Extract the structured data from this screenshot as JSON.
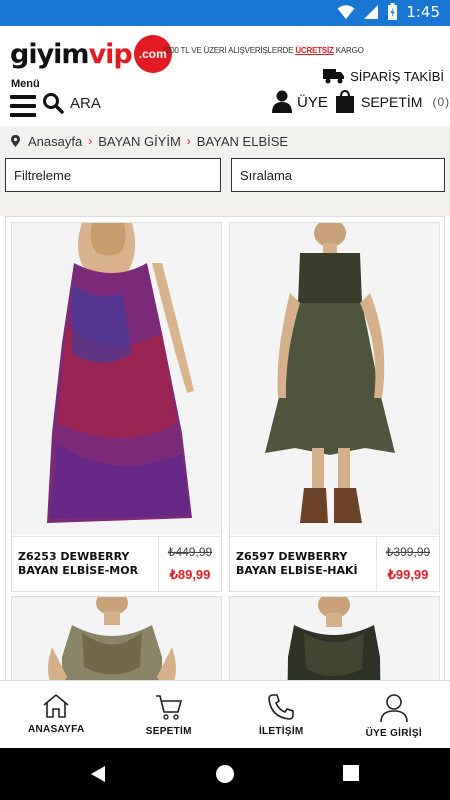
{
  "status_bar": {
    "time": "1:45"
  },
  "header": {
    "logo_text_main": "giyim",
    "logo_text_accent": "vip",
    "logo_badge": ".com",
    "promo_prefix": "*200 TL VE ÜZERİ ALIŞVERİŞLERDE",
    "promo_highlight": "ÜCRETSİZ",
    "promo_suffix": "KARGO",
    "order_tracking_label": "SİPARİŞ TAKİBİ",
    "menu_label": "Menü",
    "search_label": "ARA",
    "account_label": "ÜYE",
    "cart_label": "SEPETİM",
    "cart_count": "(0)"
  },
  "breadcrumb": {
    "items": [
      "Anasayfa",
      "BAYAN GİYİM",
      "BAYAN ELBİSE"
    ]
  },
  "filters": {
    "filter_label": "Filtreleme",
    "sort_label": "Sıralama"
  },
  "products": [
    {
      "name": "Z6253 DEWBERRY BAYAN ELBİSE-MOR",
      "old_price": "₺449,99",
      "new_price": "₺89,99",
      "color": "#7b2a7a"
    },
    {
      "name": "Z6597 DEWBERRY BAYAN ELBİSE-HAKİ",
      "old_price": "₺399,99",
      "new_price": "₺99,99",
      "color": "#4f553c"
    },
    {
      "name": "",
      "old_price": "",
      "new_price": "",
      "color": "#8a8566"
    },
    {
      "name": "",
      "old_price": "",
      "new_price": "",
      "color": "#2f3226"
    }
  ],
  "bottom_nav": {
    "items": [
      {
        "label": "ANASAYFA",
        "icon": "home-icon"
      },
      {
        "label": "SEPETİM",
        "icon": "cart-icon"
      },
      {
        "label": "İLETİŞİM",
        "icon": "phone-icon"
      },
      {
        "label": "ÜYE GİRİŞİ",
        "icon": "user-icon"
      }
    ]
  },
  "colors": {
    "accent": "#e21b23",
    "status_bar": "#1976d2",
    "breadcrumb_bg": "#f2f1ee"
  }
}
